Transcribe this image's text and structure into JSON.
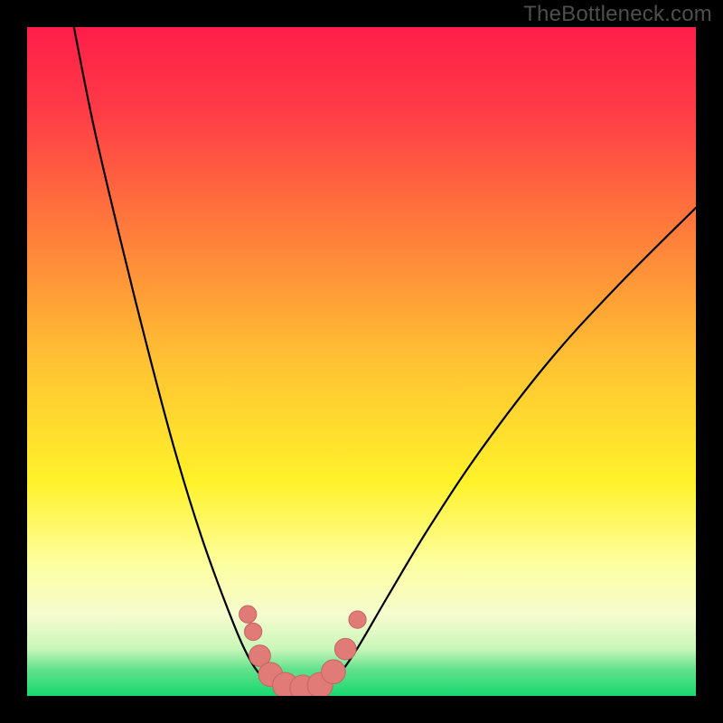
{
  "watermark": "TheBottleneck.com",
  "colors": {
    "black": "#000000",
    "watermark_text": "#4e4e4e",
    "curve": "#000000",
    "bead_fill": "#e07b78",
    "bead_stroke": "#c56560"
  },
  "chart_data": {
    "type": "line",
    "title": "",
    "xlabel": "",
    "ylabel": "",
    "xlim": [
      0,
      100
    ],
    "ylim": [
      0,
      100
    ],
    "gradient_stops": [
      {
        "pct": 0,
        "color": "#ff1e4a"
      },
      {
        "pct": 12,
        "color": "#ff3a47"
      },
      {
        "pct": 30,
        "color": "#ff7a3b"
      },
      {
        "pct": 50,
        "color": "#ffc233"
      },
      {
        "pct": 68,
        "color": "#fff22a"
      },
      {
        "pct": 80,
        "color": "#fdfe9e"
      },
      {
        "pct": 88,
        "color": "#f5fccf"
      },
      {
        "pct": 93,
        "color": "#c9f6b8"
      },
      {
        "pct": 96,
        "color": "#63e28d"
      },
      {
        "pct": 100,
        "color": "#18d86f"
      }
    ],
    "series": [
      {
        "name": "left-curve",
        "points": [
          {
            "x": 7,
            "y": 100
          },
          {
            "x": 10,
            "y": 85
          },
          {
            "x": 14,
            "y": 68
          },
          {
            "x": 18,
            "y": 52
          },
          {
            "x": 22,
            "y": 37
          },
          {
            "x": 26,
            "y": 24
          },
          {
            "x": 30,
            "y": 13
          },
          {
            "x": 33,
            "y": 6
          },
          {
            "x": 35.5,
            "y": 2.5
          },
          {
            "x": 38,
            "y": 1
          }
        ]
      },
      {
        "name": "floor",
        "points": [
          {
            "x": 38,
            "y": 1
          },
          {
            "x": 44,
            "y": 1
          }
        ]
      },
      {
        "name": "right-curve",
        "points": [
          {
            "x": 44,
            "y": 1
          },
          {
            "x": 46,
            "y": 2.5
          },
          {
            "x": 49,
            "y": 6.5
          },
          {
            "x": 54,
            "y": 15
          },
          {
            "x": 60,
            "y": 25
          },
          {
            "x": 68,
            "y": 37
          },
          {
            "x": 78,
            "y": 50
          },
          {
            "x": 88,
            "y": 61
          },
          {
            "x": 100,
            "y": 73
          }
        ]
      }
    ],
    "beads": [
      {
        "x": 33.0,
        "y": 12.2,
        "r": 1.3
      },
      {
        "x": 33.8,
        "y": 9.6,
        "r": 1.3
      },
      {
        "x": 34.8,
        "y": 6.0,
        "r": 1.6
      },
      {
        "x": 36.4,
        "y": 3.2,
        "r": 1.8
      },
      {
        "x": 38.6,
        "y": 1.6,
        "r": 1.9
      },
      {
        "x": 41.2,
        "y": 1.2,
        "r": 1.9
      },
      {
        "x": 43.8,
        "y": 1.6,
        "r": 1.9
      },
      {
        "x": 45.8,
        "y": 3.6,
        "r": 1.8
      },
      {
        "x": 47.6,
        "y": 7.0,
        "r": 1.6
      },
      {
        "x": 49.4,
        "y": 11.4,
        "r": 1.3
      }
    ]
  }
}
